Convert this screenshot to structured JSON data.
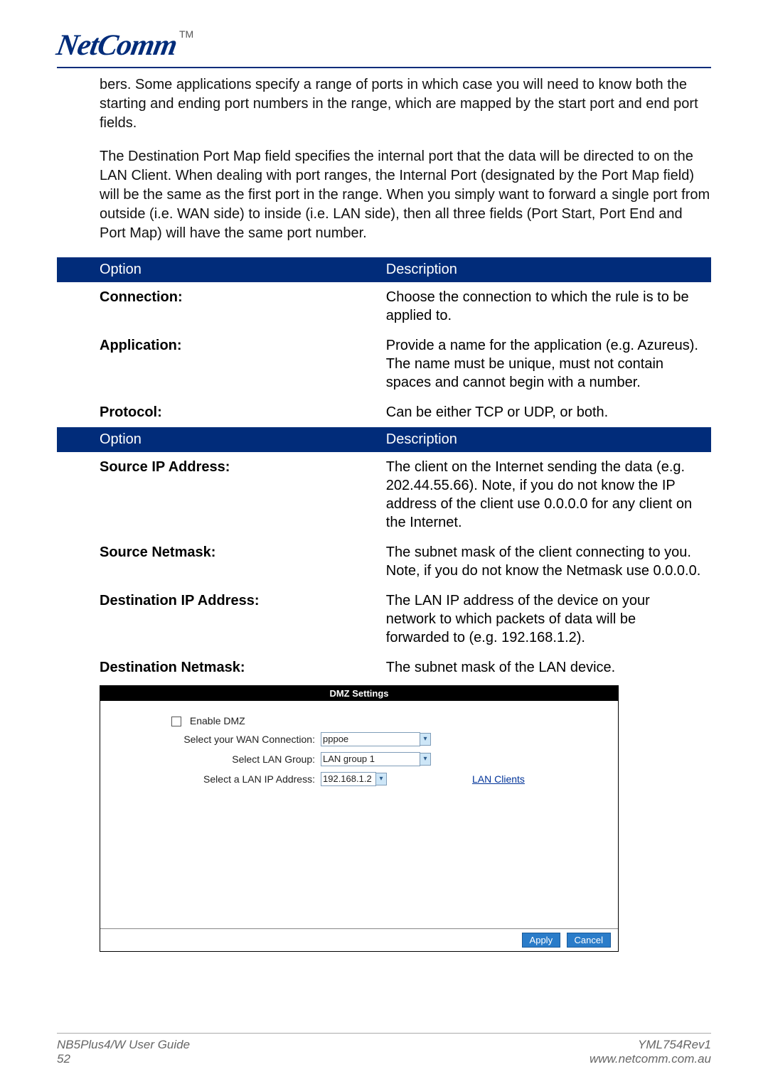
{
  "logo": {
    "text": "NetComm",
    "tm": "TM"
  },
  "paragraphs": {
    "p1": "bers. Some applications specify a range of ports in which case you will need to know both the starting and ending port numbers in the range, which are mapped by the start port and end port fields.",
    "p2": "The Destination Port Map field specifies the internal port that the data will be directed to on the LAN Client. When dealing with port ranges, the Internal Port (designated by the Port Map field) will be the same as the first port in the range. When you simply want to forward a single port from outside (i.e. WAN side) to inside (i.e. LAN side), then all three fields (Port Start, Port End and Port Map) will have the same port number."
  },
  "table1": {
    "header": {
      "col1": "Option",
      "col2": "Description"
    },
    "rows": [
      {
        "opt": "Connection:",
        "desc": "Choose the connection to which the rule is to be applied to."
      },
      {
        "opt": "Application:",
        "desc": "Provide a name for the application (e.g. Azureus).  The name must be unique, must not contain spaces and cannot begin with a number."
      },
      {
        "opt": "Protocol:",
        "desc": "Can be either TCP or UDP, or both."
      }
    ]
  },
  "table2": {
    "header": {
      "col1": "Option",
      "col2": "Description"
    },
    "rows": [
      {
        "opt": "Source IP Address:",
        "desc": "The client on the Internet sending the data (e.g. 202.44.55.66). Note, if you do not know the IP address of the client use 0.0.0.0 for any client on the Internet."
      },
      {
        "opt": "Source Netmask:",
        "desc": "The subnet mask  of the client connecting to you. Note, if you do not know the Netmask use 0.0.0.0."
      },
      {
        "opt": "Destination IP Address:",
        "desc": "The LAN IP address of the device on your network to which packets of data will be forwarded to (e.g. 192.168.1.2)."
      },
      {
        "opt": "Destination Netmask:",
        "desc": "The subnet mask of the LAN device."
      }
    ]
  },
  "dmz": {
    "title": "DMZ Settings",
    "enable_label": "Enable DMZ",
    "wan_label": "Select your WAN Connection:",
    "wan_value": "pppoe",
    "lan_group_label": "Select LAN Group:",
    "lan_group_value": "LAN group 1",
    "lan_ip_label": "Select a LAN IP Address:",
    "lan_ip_value": "192.168.1.2",
    "lan_clients_link": "LAN Clients",
    "apply": "Apply",
    "cancel": "Cancel"
  },
  "footer": {
    "left1": "NB5Plus4/W User Guide",
    "left2": "52",
    "right1": "YML754Rev1",
    "right2": "www.netcomm.com.au"
  }
}
